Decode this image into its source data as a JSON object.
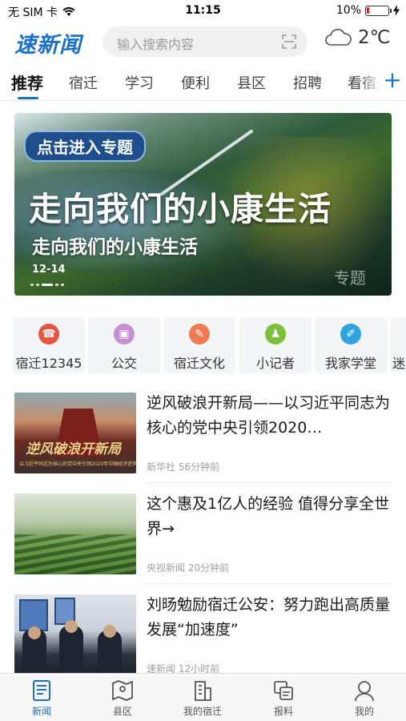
{
  "status_bar": {
    "carrier": "无 SIM 卡",
    "time": "11:15",
    "battery": "10%",
    "battery_level": 0.1
  },
  "header": {
    "logo": "速新闻",
    "search_placeholder": "输入搜索内容",
    "temperature": "2℃",
    "weather_icon": "cloud-icon"
  },
  "tabs": [
    "推荐",
    "宿迁",
    "学习",
    "便利",
    "县区",
    "招聘",
    "看宿迁"
  ],
  "active_tab": "推荐",
  "banner": {
    "tag": "点击进入专题",
    "headline": "走向我们的小康生活",
    "caption": "走向我们的小康生活",
    "date": "12-14",
    "watermark": "专题"
  },
  "shortcuts": [
    {
      "label": "宿迁12345",
      "icon": "phone-icon",
      "color": "#e8553f"
    },
    {
      "label": "公交",
      "icon": "bus-icon",
      "color": "#c58fd6"
    },
    {
      "label": "宿迁文化",
      "icon": "culture-icon",
      "color": "#f07a52"
    },
    {
      "label": "小记者",
      "icon": "reporter-icon",
      "color": "#7cbf3a"
    },
    {
      "label": "我家学堂",
      "icon": "pen-icon",
      "color": "#2fa3e0"
    },
    {
      "label": "迷",
      "icon": "more-icon",
      "color": "#cccccc"
    }
  ],
  "news": [
    {
      "title": "逆风破浪开新局——以习近平同志为核心的党中央引领2020…",
      "source": "新华社",
      "time": "56分钟前",
      "thumb_text": "逆风破浪开新局",
      "thumb_sub": "以习近平同志为核心的党中央引领2020年中国经济逆风破浪开新局"
    },
    {
      "title": "这个惠及1亿人的经验 值得分享全世界→",
      "source": "央视新闻",
      "time": "20分钟前"
    },
    {
      "title": "刘旸勉励宿迁公安：努力跑出高质量发展“加速度”",
      "source": "速新闻",
      "time": "12小时前"
    }
  ],
  "bottom_nav": [
    {
      "label": "新闻",
      "icon": "news-icon",
      "active": true
    },
    {
      "label": "县区",
      "icon": "map-icon",
      "active": false
    },
    {
      "label": "我的宿迁",
      "icon": "building-icon",
      "active": false
    },
    {
      "label": "报料",
      "icon": "report-icon",
      "active": false
    },
    {
      "label": "我的",
      "icon": "user-icon",
      "active": false
    }
  ],
  "colors": {
    "accent": "#1a6fc9",
    "battery_low": "#e02020"
  }
}
